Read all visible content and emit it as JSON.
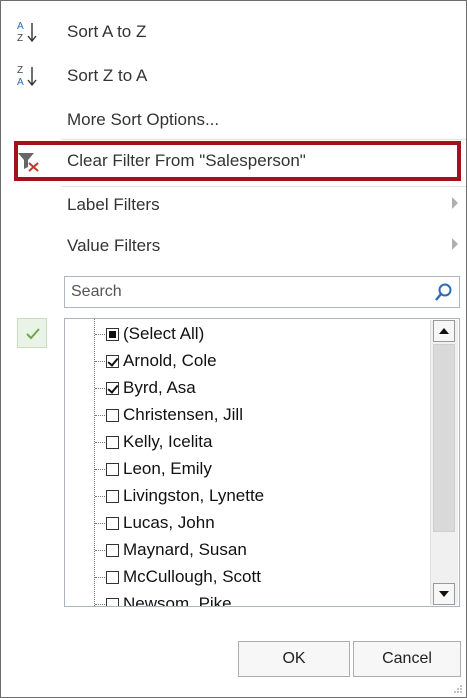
{
  "menu": {
    "sort_az": {
      "label": "Sort A to Z",
      "icon": "sort-ascending-icon"
    },
    "sort_za": {
      "label": "Sort Z to A",
      "icon": "sort-descending-icon"
    },
    "more_sort": {
      "label": "More Sort Options..."
    },
    "clear_filter": {
      "label": "Clear Filter From \"Salesperson\"",
      "icon": "clear-filter-icon"
    },
    "label_filters": {
      "label": "Label Filters"
    },
    "value_filters": {
      "label": "Value Filters"
    }
  },
  "search": {
    "placeholder": "Search",
    "value": ""
  },
  "list": {
    "items": [
      {
        "label": "(Select All)",
        "state": "mixed"
      },
      {
        "label": "Arnold, Cole",
        "state": "checked"
      },
      {
        "label": "Byrd, Asa",
        "state": "checked"
      },
      {
        "label": "Christensen, Jill",
        "state": "unchecked"
      },
      {
        "label": "Kelly, Icelita",
        "state": "unchecked"
      },
      {
        "label": "Leon, Emily",
        "state": "unchecked"
      },
      {
        "label": "Livingston, Lynette",
        "state": "unchecked"
      },
      {
        "label": "Lucas, John",
        "state": "unchecked"
      },
      {
        "label": "Maynard, Susan",
        "state": "unchecked"
      },
      {
        "label": "McCullough, Scott",
        "state": "unchecked"
      },
      {
        "label": "Newsom, Pike",
        "state": "unchecked"
      }
    ]
  },
  "buttons": {
    "ok": "OK",
    "cancel": "Cancel"
  },
  "colors": {
    "highlight_border": "#a0131c",
    "filter_x": "#c0392b",
    "checkmark": "#6aaa4f"
  }
}
